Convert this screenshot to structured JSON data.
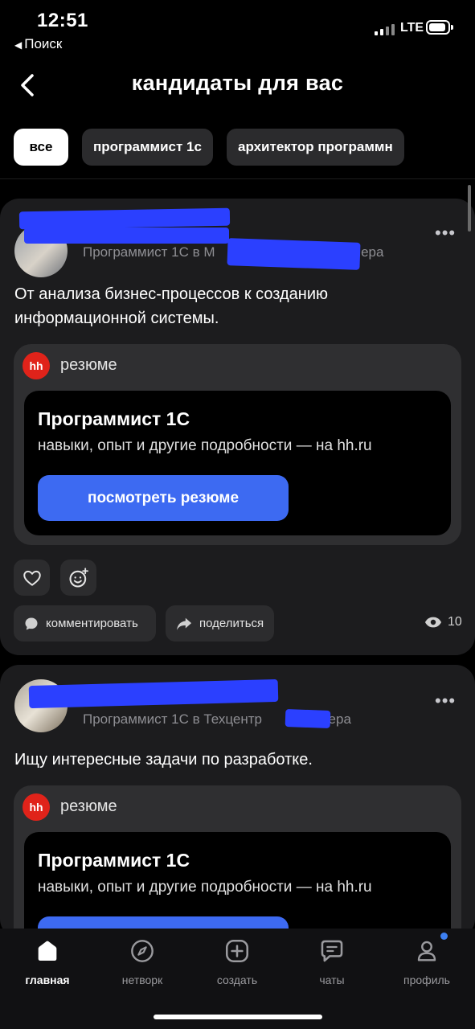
{
  "status_bar": {
    "time": "12:51",
    "back_app": "Поиск",
    "network": "LTE"
  },
  "header": {
    "title": "кандидаты для вас"
  },
  "filters": [
    {
      "label": "все",
      "active": true
    },
    {
      "label": "программист 1с",
      "active": false
    },
    {
      "label": "архитектор программн",
      "active": false
    }
  ],
  "posts": [
    {
      "author_meta_start": "Программист 1С в М",
      "author_meta_time": "вчера",
      "text": "От анализа бизнес-процессов к созданию информационной системы.",
      "resume_label": "резюме",
      "hh_logo": "hh",
      "resume_title": "Программист 1С",
      "resume_subtitle": "навыки, опыт и другие подробности — на hh.ru",
      "cta_label": "посмотреть резюме",
      "comment_label": "комментировать",
      "share_label": "поделиться",
      "views": "10"
    },
    {
      "author_meta_start": "Программист 1С в Техцентр",
      "author_meta_time": "вчера",
      "text": "Ищу интересные задачи по разработке.",
      "resume_label": "резюме",
      "hh_logo": "hh",
      "resume_title": "Программист 1С",
      "resume_subtitle": "навыки, опыт и другие подробности — на hh.ru"
    }
  ],
  "nav": [
    {
      "label": "главная",
      "icon": "home-icon",
      "active": true
    },
    {
      "label": "нетворк",
      "icon": "compass-icon",
      "active": false
    },
    {
      "label": "создать",
      "icon": "plus-icon",
      "active": false
    },
    {
      "label": "чаты",
      "icon": "chat-icon",
      "active": false
    },
    {
      "label": "профиль",
      "icon": "user-icon",
      "active": false
    }
  ],
  "colors": {
    "accent": "#3d6af2",
    "hh_red": "#e0231a",
    "redaction": "#2b40ff",
    "badge": "#3d80f2"
  }
}
